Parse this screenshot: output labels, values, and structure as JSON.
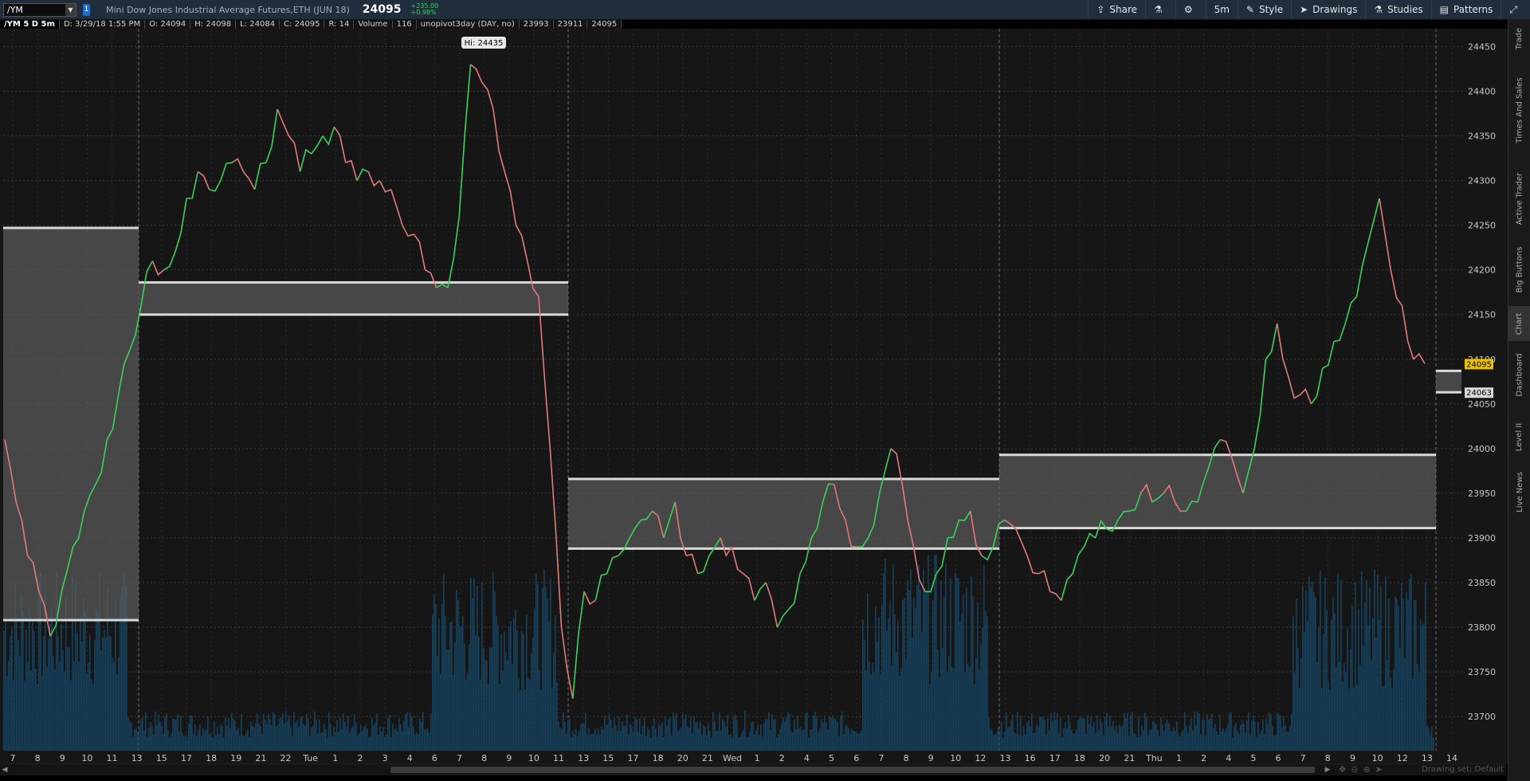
{
  "header": {
    "symbol": "/YM",
    "description": "Mini Dow Jones Industrial Average Futures,ETH (JUN 18)",
    "last_price": "24095",
    "change": "+235.00",
    "change_pct": "+0.98%",
    "tools": [
      "Share",
      "5m",
      "Style",
      "Drawings",
      "Studies",
      "Patterns"
    ]
  },
  "infobar": {
    "timeframe": "/YM 5 D 5m",
    "date": "D: 3/29/18 1:55 PM",
    "open": "O: 24094",
    "high": "H: 24098",
    "low": "L: 24084",
    "close": "C: 24095",
    "range": "R: 14",
    "volume_label": "Volume",
    "volume": "116",
    "study": "unopivot3day (DAY, no)",
    "pivot1": "23993",
    "pivot2": "23911",
    "pivot3": "24095"
  },
  "chart_data": {
    "type": "line",
    "xlabel": "",
    "ylabel": "",
    "ylim": [
      23660,
      24470
    ],
    "y_ticks": [
      23700,
      23750,
      23800,
      23850,
      23900,
      23950,
      24000,
      24050,
      24100,
      24150,
      24200,
      24250,
      24300,
      24350,
      24400,
      24450
    ],
    "x_tick_labels": [
      "7",
      "8",
      "9",
      "10",
      "11",
      "13",
      "15",
      "17",
      "18",
      "19",
      "21",
      "22",
      "Tue",
      "1",
      "2",
      "3",
      "4",
      "6",
      "7",
      "8",
      "9",
      "10",
      "11",
      "13",
      "15",
      "17",
      "18",
      "20",
      "21",
      "Wed",
      "1",
      "2",
      "4",
      "5",
      "6",
      "7",
      "8",
      "9",
      "10",
      "12",
      "13",
      "16",
      "17",
      "18",
      "20",
      "21",
      "Thu",
      "1",
      "2",
      "4",
      "5",
      "6",
      "7",
      "8",
      "9",
      "10",
      "12",
      "13",
      "14"
    ],
    "high_label": "Hi: 24435",
    "last_price_label": "24095",
    "pivot_label": "24063",
    "colors": {
      "up": "#38d35b",
      "down": "#e37a7a",
      "volume": "#1d3f55",
      "zone": "#5c5c5c",
      "zone_line": "#d9d9d9",
      "last_tag": "#f0c000"
    },
    "series": [
      {
        "values": [
          24010,
          23940,
          23880,
          23840,
          23790,
          23840,
          23890,
          23930,
          23960,
          24010,
          24060,
          24110,
          24160,
          24210,
          24200,
          24220,
          24280,
          24310,
          24290,
          24300,
          24320,
          24310,
          24290,
          24320,
          24380,
          24350,
          24310,
          24330,
          24350,
          24360,
          24320,
          24300,
          24310,
          24300,
          24290,
          24250,
          24240,
          24200,
          24180,
          24180,
          24260,
          24430,
          24410,
          24380,
          24310,
          24250,
          24210,
          24170,
          24000,
          23800,
          23720,
          23840,
          23830,
          23860,
          23880,
          23900,
          23920,
          23930,
          23900,
          23940,
          23880,
          23860,
          23880,
          23900,
          23890,
          23860,
          23830,
          23850,
          23800,
          23820,
          23860,
          23900,
          23940,
          23960,
          23920,
          23890,
          23900,
          23950,
          24000,
          23960,
          23890,
          23840,
          23860,
          23900,
          23920,
          23930,
          23880,
          23890,
          23920,
          23910,
          23880,
          23860,
          23840,
          23830,
          23860,
          23890,
          23900,
          23910,
          23920,
          23930,
          23950,
          23940,
          23950,
          23940,
          23930,
          23940,
          23980,
          24010,
          23990,
          23950,
          24000,
          24100,
          24140,
          24080,
          24060,
          24050,
          24090,
          24120,
          24140,
          24170,
          24230,
          24280,
          24200,
          24160,
          24100,
          24095
        ]
      }
    ],
    "pivot_zones": [
      {
        "top": 24247,
        "bottom": 23808
      },
      {
        "top": 24186,
        "bottom": 24150
      },
      {
        "top": 23966,
        "bottom": 23888
      },
      {
        "top": 23993,
        "bottom": 23911
      },
      {
        "top": 24087,
        "bottom": 24063
      }
    ]
  },
  "right_tabs": [
    "Trade",
    "Times And Sales",
    "Active Trader",
    "Big Buttons",
    "Chart",
    "Dashboard",
    "Level II",
    "Live News"
  ],
  "footer": {
    "drawing_set": "Drawing set: Default"
  }
}
